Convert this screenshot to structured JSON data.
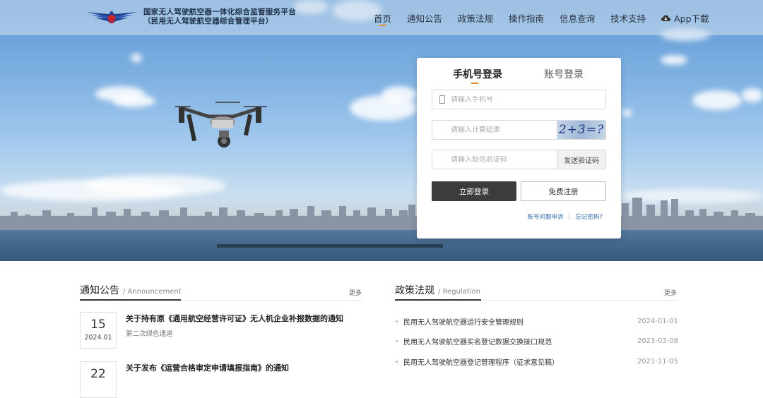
{
  "header": {
    "title_line1": "国家无人驾驶航空器一体化综合监管服务平台",
    "title_line2": "（民用无人驾驶航空器综合管理平台）",
    "nav": [
      {
        "label": "首页",
        "active": true
      },
      {
        "label": "通知公告"
      },
      {
        "label": "政策法规"
      },
      {
        "label": "操作指南"
      },
      {
        "label": "信息查询"
      },
      {
        "label": "技术支持"
      }
    ],
    "app_download": "App下载"
  },
  "login": {
    "tab_phone": "手机号登录",
    "tab_account": "账号登录",
    "phone_placeholder": "请输入手机号",
    "calc_placeholder": "请输入计算结果",
    "captcha_text": "2+3=?",
    "sms_placeholder": "请输入短信验证码",
    "send_code": "发送验证码",
    "login_button": "立即登录",
    "register_button": "免费注册",
    "account_problem": "账号问题申诉",
    "forgot_password": "忘记密码?"
  },
  "notices": {
    "title": "通知公告",
    "subtitle": "/ Announcement",
    "more": "更多",
    "items": [
      {
        "day": "15",
        "ym": "2024.01",
        "title": "关于持有原《通用航空经营许可证》无人机企业补报数据的通知",
        "sub": "第二次绿色通道"
      },
      {
        "day": "22",
        "ym": "",
        "title": "关于发布《运营合格审定申请填报指南》的通知",
        "sub": ""
      }
    ]
  },
  "regulations": {
    "title": "政策法规",
    "subtitle": "/ Regulation",
    "more": "更多",
    "items": [
      {
        "title": "民用无人驾驶航空器运行安全管理规则",
        "date": "2024-01-01"
      },
      {
        "title": "民用无人驾驶航空器实名登记数据交换接口规范",
        "date": "2023-03-08"
      },
      {
        "title": "民用无人驾驶航空器登记管理程序（征求意见稿）",
        "date": "2021-11-05"
      }
    ]
  },
  "colors": {
    "accent": "#e58a1f",
    "login_btn": "#3c3c3c",
    "link": "#3a6fb0"
  }
}
